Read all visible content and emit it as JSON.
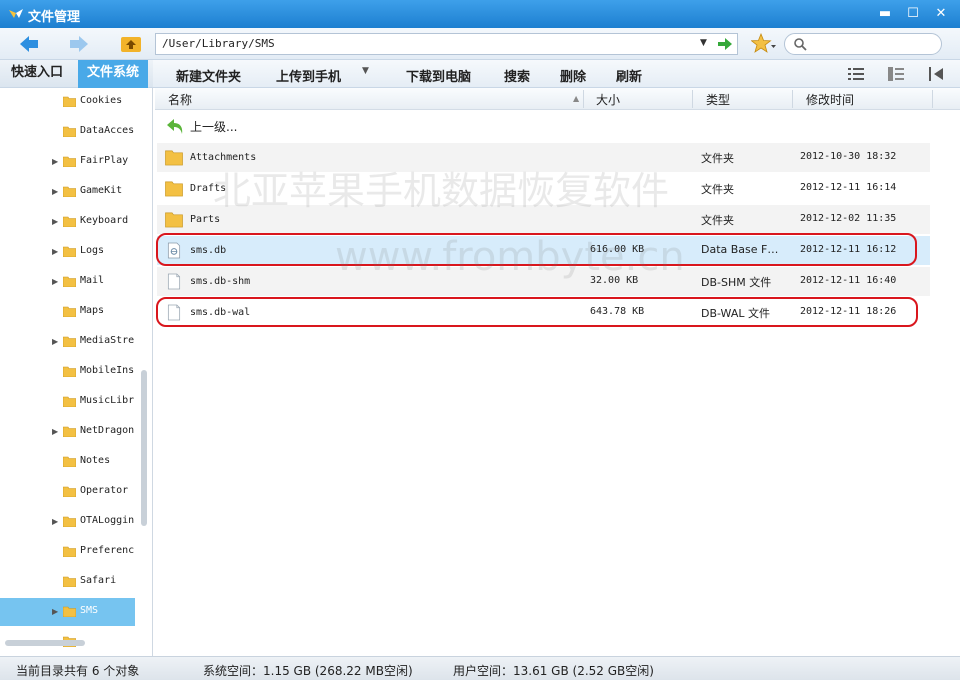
{
  "window": {
    "title": "文件管理",
    "controls": {
      "minimize": "▬",
      "maximize": "☐",
      "close": "✕"
    }
  },
  "address_bar": {
    "path": "/User/Library/SMS",
    "dropdown_glyph": "▼",
    "search_placeholder": ""
  },
  "left_tabs": [
    "快速入口",
    "文件系统"
  ],
  "toolbar": {
    "new_folder": "新建文件夹",
    "upload": "上传到手机",
    "download": "下载到电脑",
    "search": "搜索",
    "delete": "删除",
    "refresh": "刷新",
    "upload_arrow": "▼"
  },
  "sidebar": {
    "items": [
      {
        "label": "Cookies",
        "expandable": false,
        "arrow": ""
      },
      {
        "label": "DataAcces",
        "expandable": false,
        "arrow": ""
      },
      {
        "label": "FairPlay",
        "expandable": true,
        "arrow": "▶"
      },
      {
        "label": "GameKit",
        "expandable": true,
        "arrow": "▶"
      },
      {
        "label": "Keyboard",
        "expandable": true,
        "arrow": "▶"
      },
      {
        "label": "Logs",
        "expandable": true,
        "arrow": "▶"
      },
      {
        "label": "Mail",
        "expandable": true,
        "arrow": "▶"
      },
      {
        "label": "Maps",
        "expandable": false,
        "arrow": ""
      },
      {
        "label": "MediaStre",
        "expandable": true,
        "arrow": "▶"
      },
      {
        "label": "MobileIns",
        "expandable": false,
        "arrow": ""
      },
      {
        "label": "MusicLibr",
        "expandable": false,
        "arrow": ""
      },
      {
        "label": "NetDragon",
        "expandable": true,
        "arrow": "▶"
      },
      {
        "label": "Notes",
        "expandable": false,
        "arrow": ""
      },
      {
        "label": "Operator",
        "expandable": false,
        "arrow": ""
      },
      {
        "label": "OTALoggin",
        "expandable": true,
        "arrow": "▶"
      },
      {
        "label": "Preferenc",
        "expandable": false,
        "arrow": ""
      },
      {
        "label": "Safari",
        "expandable": false,
        "arrow": ""
      },
      {
        "label": "SMS",
        "expandable": true,
        "arrow": "▶",
        "selected": true
      }
    ]
  },
  "file_list": {
    "columns": {
      "name": "名称",
      "size": "大小",
      "type": "类型",
      "modified": "修改时间"
    },
    "sort_glyph": "▲",
    "up_level": "上一级...",
    "rows": [
      {
        "name": "Attachments",
        "size": "",
        "type": "文件夹",
        "modified": "2012-10-30 18:32",
        "icon": "folder-icon"
      },
      {
        "name": "Drafts",
        "size": "",
        "type": "文件夹",
        "modified": "2012-12-11 16:14",
        "icon": "folder-icon"
      },
      {
        "name": "Parts",
        "size": "",
        "type": "文件夹",
        "modified": "2012-12-02 11:35",
        "icon": "folder-icon"
      },
      {
        "name": "sms.db",
        "size": "616.00 KB",
        "type": "Data Base F…",
        "modified": "2012-12-11 16:12",
        "icon": "database-file-icon",
        "selected": true
      },
      {
        "name": "sms.db-shm",
        "size": "32.00 KB",
        "type": "DB-SHM 文件",
        "modified": "2012-12-11 16:40",
        "icon": "file-icon"
      },
      {
        "name": "sms.db-wal",
        "size": "643.78 KB",
        "type": "DB-WAL 文件",
        "modified": "2012-12-11 18:26",
        "icon": "file-icon"
      }
    ]
  },
  "watermark": {
    "line1": "北亚苹果手机数据恢复软件",
    "line2": "www.frombyte.cn"
  },
  "status_bar": {
    "object_count": "当前目录共有 6 个对象",
    "system_space": "系统空间：1.15 GB (268.22 MB空闲)",
    "user_space": "用户空间：13.61 GB (2.52 GB空闲)"
  },
  "colors": {
    "titlebar": "#1d7fd0",
    "selected_tab": "#49a9e8",
    "selected_tree": "#76c4f0",
    "selected_row": "#d7ecfb",
    "highlight": "#d9161d",
    "folder": "#f3c043"
  }
}
